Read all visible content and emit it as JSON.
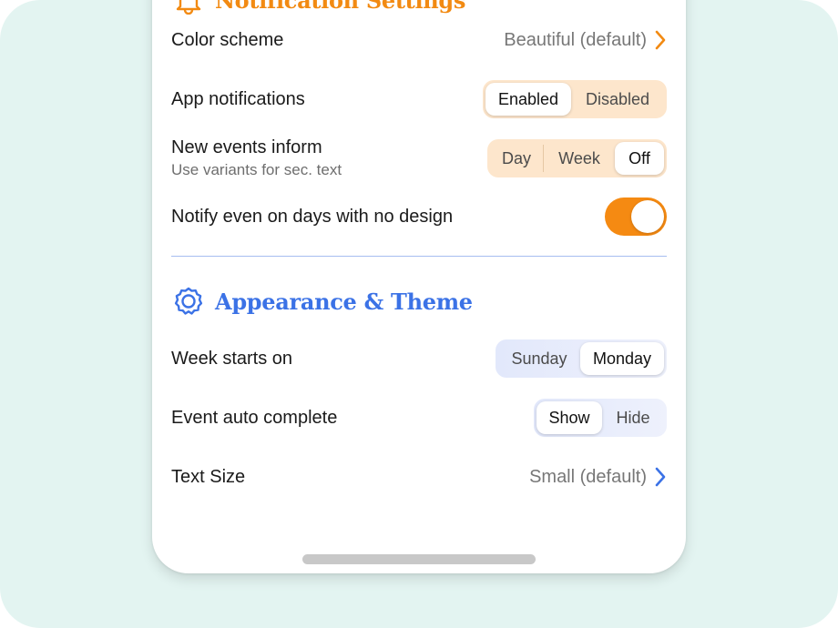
{
  "notifications": {
    "title": "Notification Settings",
    "icon": "bell-icon",
    "accent": "#f28a12",
    "rows": {
      "color_scheme": {
        "label": "Color scheme",
        "value": "Beautiful (default)"
      },
      "app_notifications": {
        "label": "App notifications",
        "options": [
          "Enabled",
          "Disabled"
        ],
        "selected": "Enabled"
      },
      "new_events": {
        "label": "New events inform",
        "sublabel": "Use variants for sec. text",
        "options": [
          "Day",
          "Week",
          "Off"
        ],
        "selected": "Off"
      },
      "notify_no_design": {
        "label": "Notify even on days with no design",
        "toggle_on": true
      }
    }
  },
  "appearance": {
    "title": "Appearance & Theme",
    "icon": "gear-icon",
    "accent": "#3b72e6",
    "rows": {
      "week_starts": {
        "label": "Week starts on",
        "options": [
          "Sunday",
          "Monday"
        ],
        "selected": "Monday"
      },
      "auto_complete": {
        "label": "Event auto complete",
        "options": [
          "Show",
          "Hide"
        ],
        "selected": "Show"
      },
      "text_size": {
        "label": "Text Size",
        "value": "Small (default)"
      }
    }
  }
}
